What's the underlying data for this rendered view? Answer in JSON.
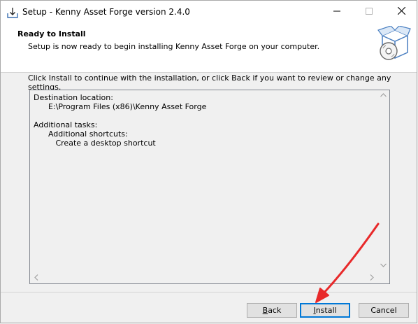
{
  "window": {
    "title": "Setup - Kenny Asset Forge version 2.4.0"
  },
  "header": {
    "title": "Ready to Install",
    "subtitle": "Setup is now ready to begin installing Kenny Asset Forge on your computer."
  },
  "instructions": "Click Install to continue with the installation, or click Back if you want to review or change any settings.",
  "memo": {
    "lines": [
      "Destination location:",
      "      E:\\Program Files (x86)\\Kenny Asset Forge",
      "",
      "Additional tasks:",
      "      Additional shortcuts:",
      "         Create a desktop shortcut"
    ]
  },
  "buttons": {
    "back": {
      "mnemonic": "B",
      "rest": "ack"
    },
    "install": {
      "mnemonic": "I",
      "rest": "nstall"
    },
    "cancel": "Cancel"
  },
  "colors": {
    "window_bg": "#f0f0f0",
    "header_bg": "#ffffff",
    "default_button_border": "#0078d7",
    "annotation_arrow": "#e8292a"
  },
  "icons": {
    "title": "setup-download-icon",
    "header": "software-box-cd-icon",
    "minimize": "minimize-icon",
    "maximize": "maximize-icon",
    "close": "close-icon"
  }
}
